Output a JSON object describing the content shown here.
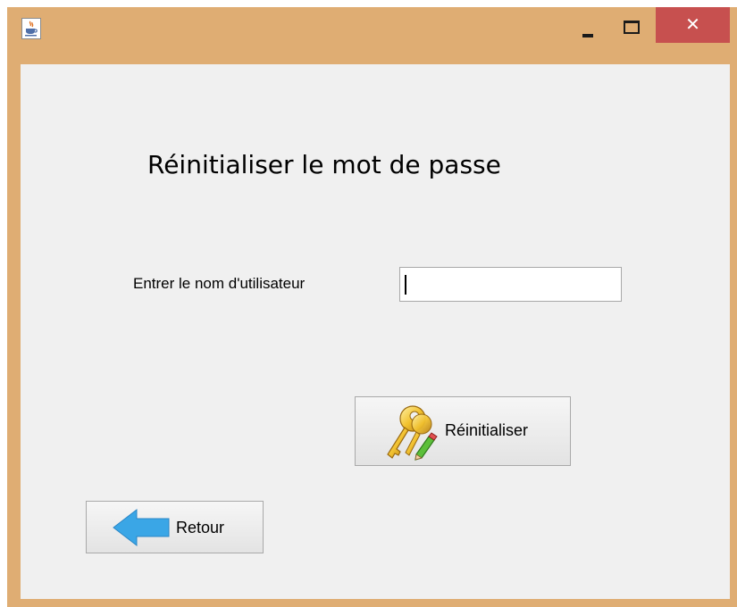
{
  "window": {
    "title_bar_color": "#dfad73",
    "app_icon": "java-cup-icon",
    "controls": {
      "minimize_icon": "minimize-icon",
      "maximize_icon": "maximize-icon",
      "close_icon": "close-icon",
      "close_symbol": "✕",
      "close_color": "#c7504f"
    }
  },
  "form": {
    "heading": "Réinitialiser le mot de passe",
    "username_label": "Entrer le nom d'utilisateur",
    "username_value": "",
    "reset_button_label": "Réinitialiser",
    "reset_button_icon": "key-pencil-icon",
    "back_button_label": "Retour",
    "back_button_icon": "arrow-left-icon"
  },
  "colors": {
    "content_background": "#f0f0f0",
    "back_arrow": "#3aa6e6"
  }
}
